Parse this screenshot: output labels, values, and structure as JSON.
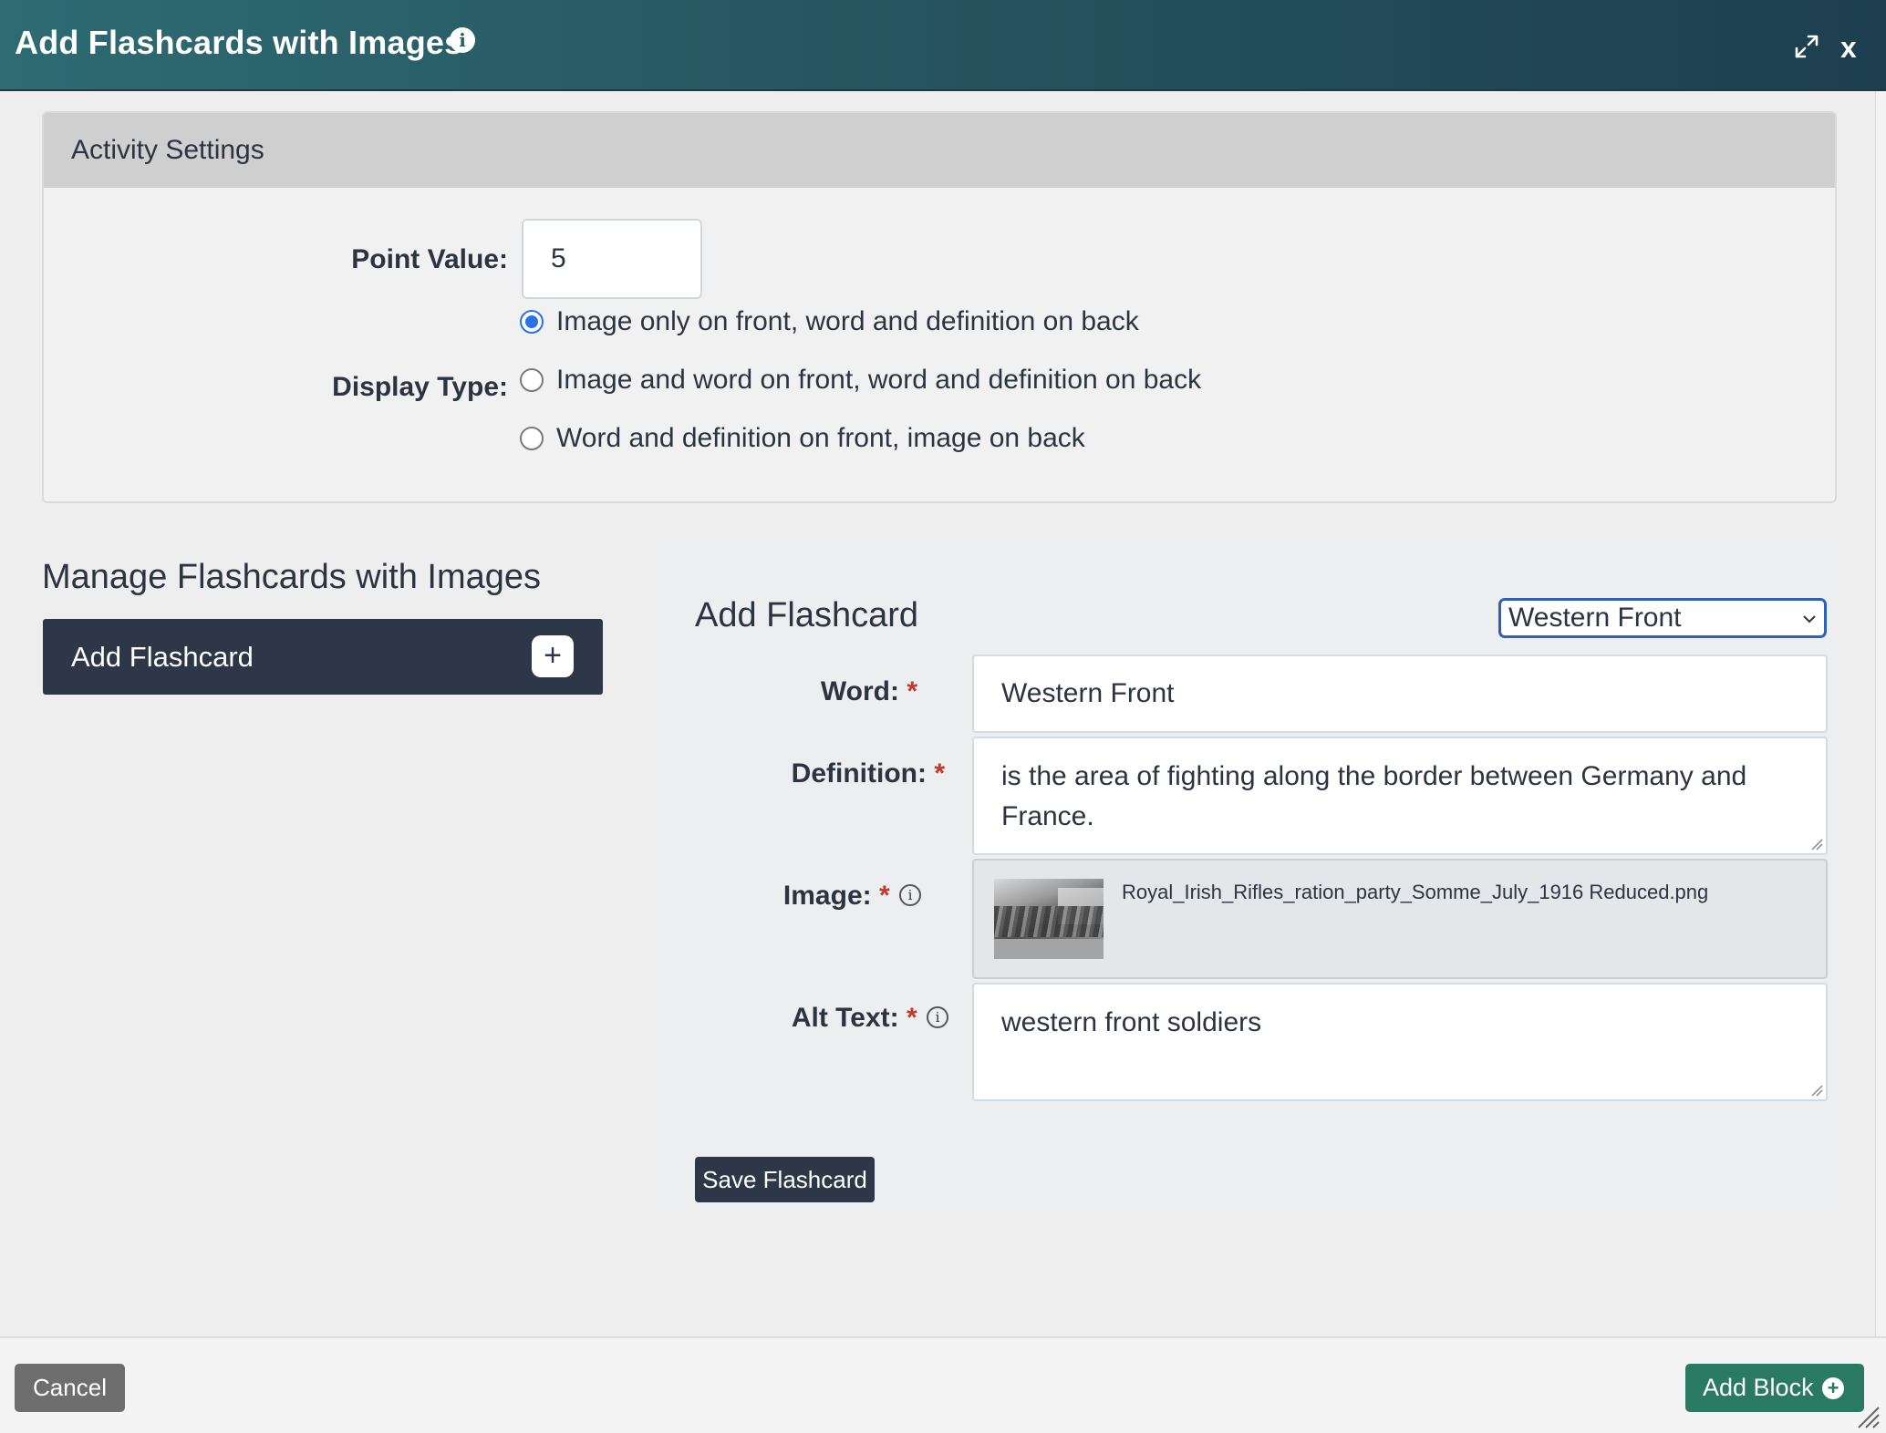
{
  "header": {
    "title": "Add Flashcards with Images",
    "info_icon": "i",
    "close_label": "x"
  },
  "settings": {
    "heading": "Activity Settings",
    "point_value_label": "Point Value:",
    "point_value": "5",
    "display_type_label": "Display Type:",
    "display_options": [
      {
        "label": "Image only on front, word and definition on back",
        "checked": true
      },
      {
        "label": "Image and word on front, word and definition on back",
        "checked": false
      },
      {
        "label": "Word and definition on front, image on back",
        "checked": false
      }
    ]
  },
  "manage": {
    "title": "Manage Flashcards with Images",
    "add_button_label": "Add Flashcard",
    "add_button_plus": "+"
  },
  "form": {
    "title": "Add Flashcard",
    "selected_card": "Western Front",
    "word_label": "Word:",
    "word_value": "Western Front",
    "definition_label": "Definition:",
    "definition_value": "is the area of fighting along the border between Germany and France.",
    "image_label": "Image:",
    "image_filename": "Royal_Irish_Rifles_ration_party_Somme_July_1916 Reduced.png",
    "alt_label": "Alt Text:",
    "alt_value": "western front soldiers",
    "required_mark": "*",
    "small_info": "i",
    "save_label": "Save Flashcard"
  },
  "footer": {
    "cancel_label": "Cancel",
    "add_block_label": "Add Block",
    "add_block_plus": "+"
  },
  "colors": {
    "header_gradient_start": "#2e6b73",
    "header_gradient_end": "#1d3f50",
    "dark_button": "#2d3748",
    "add_block_green": "#2a7a62",
    "required_red": "#c0392b",
    "radio_blue": "#2a72e6"
  },
  "icons": [
    "info-icon",
    "expand-icon",
    "close-icon",
    "plus-icon",
    "chevron-down-icon",
    "plus-circle-icon"
  ]
}
